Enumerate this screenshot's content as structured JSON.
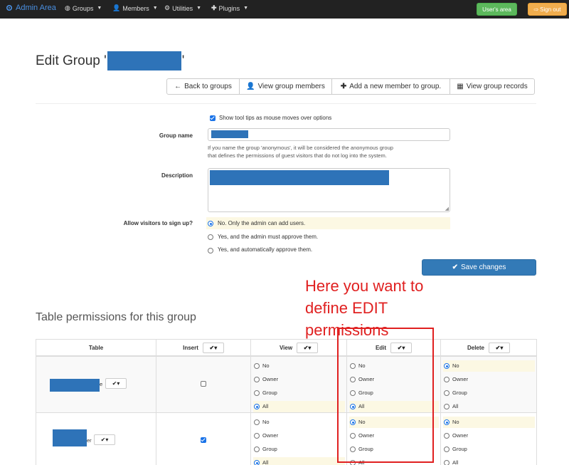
{
  "nav": {
    "brand": "Admin Area",
    "items": [
      "Groups",
      "Members",
      "Utilities",
      "Plugins"
    ],
    "users_area": "User's area",
    "sign_out": "Sign out"
  },
  "title": {
    "prefix": "Edit Group '",
    "suffix": "'"
  },
  "actions": {
    "back": "Back to groups",
    "view_members": "View group members",
    "add_member": "Add a new member to group.",
    "view_records": "View group records"
  },
  "form": {
    "tooltips_label": "Show tool tips as mouse moves over options",
    "group_name_label": "Group name",
    "group_name_help_1": "If you name the group 'anonymous', it will be considered the anonymous group",
    "group_name_help_2": "that defines the permissions of guest visitors that do not log into the system.",
    "description_label": "Description",
    "signup_label": "Allow visitors to sign up?",
    "signup_options": [
      "No. Only the admin can add users.",
      "Yes, and the admin must approve them.",
      "Yes, and automatically approve them."
    ],
    "save": "Save changes"
  },
  "annotation": {
    "line1": "Here you want to",
    "line2": "define EDIT",
    "line3": "permissions"
  },
  "permissions": {
    "title": "Table permissions for this group",
    "columns": [
      "Table",
      "Insert",
      "View",
      "Edit",
      "Delete"
    ],
    "options": [
      "No",
      "Owner",
      "Group",
      "All"
    ],
    "rows": [
      {
        "table_suffix": "e",
        "insert": false,
        "view": "All",
        "edit": "All",
        "delete": "No"
      },
      {
        "table_suffix": "er",
        "insert": true,
        "view": "All",
        "edit": "No",
        "delete": "No"
      }
    ]
  }
}
